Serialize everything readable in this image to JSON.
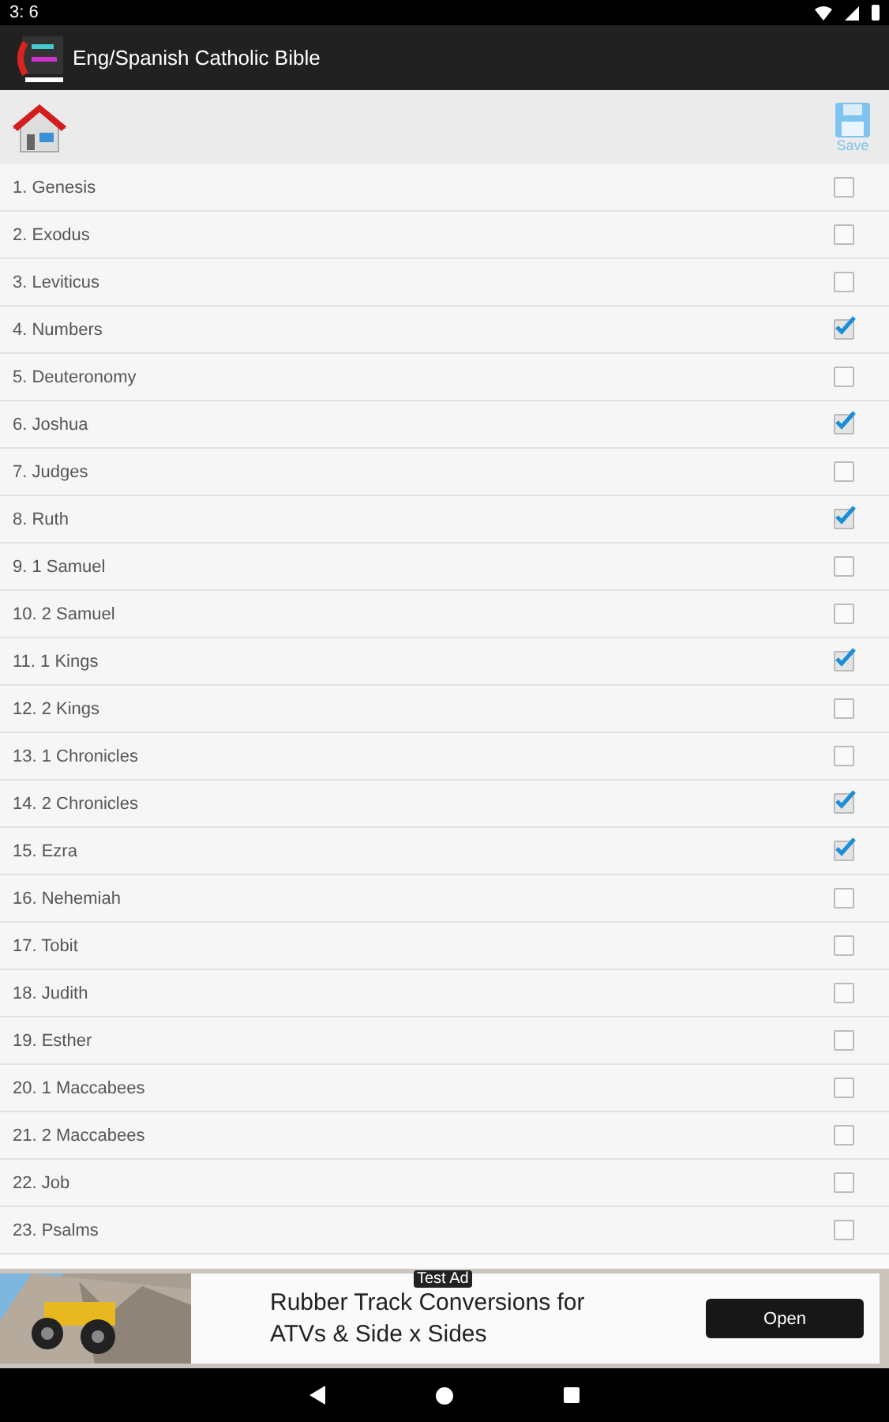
{
  "status_bar": {
    "time": "3: 6"
  },
  "app_bar": {
    "title": "Eng/Spanish Catholic Bible"
  },
  "toolbar": {
    "save_label": "Save"
  },
  "books": [
    {
      "label": "1. Genesis",
      "checked": false
    },
    {
      "label": "2. Exodus",
      "checked": false
    },
    {
      "label": "3. Leviticus",
      "checked": false
    },
    {
      "label": "4. Numbers",
      "checked": true
    },
    {
      "label": "5. Deuteronomy",
      "checked": false
    },
    {
      "label": "6. Joshua",
      "checked": true
    },
    {
      "label": "7. Judges",
      "checked": false
    },
    {
      "label": "8. Ruth",
      "checked": true
    },
    {
      "label": "9. 1 Samuel",
      "checked": false
    },
    {
      "label": "10. 2 Samuel",
      "checked": false
    },
    {
      "label": "11. 1 Kings",
      "checked": true
    },
    {
      "label": "12. 2 Kings",
      "checked": false
    },
    {
      "label": "13. 1 Chronicles",
      "checked": false
    },
    {
      "label": "14. 2 Chronicles",
      "checked": true
    },
    {
      "label": "15. Ezra",
      "checked": true
    },
    {
      "label": "16. Nehemiah",
      "checked": false
    },
    {
      "label": "17. Tobit",
      "checked": false
    },
    {
      "label": "18. Judith",
      "checked": false
    },
    {
      "label": "19. Esther",
      "checked": false
    },
    {
      "label": "20. 1 Maccabees",
      "checked": false
    },
    {
      "label": "21. 2 Maccabees",
      "checked": false
    },
    {
      "label": "22. Job",
      "checked": false
    },
    {
      "label": "23. Psalms",
      "checked": false
    }
  ],
  "ad": {
    "badge": "Test Ad",
    "headline": "Rubber Track Conversions for ATVs & Side x Sides",
    "button": "Open"
  }
}
